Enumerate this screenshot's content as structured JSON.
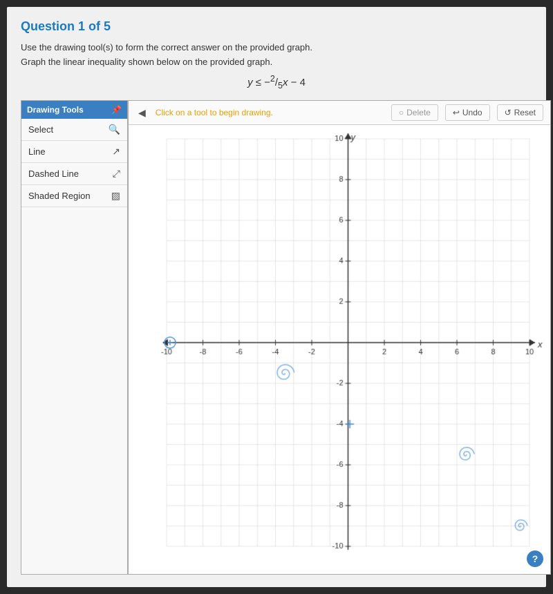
{
  "header": {
    "title": "Question 1 of 5"
  },
  "instructions": [
    "Use the drawing tool(s) to form the correct answer on the provided graph.",
    "Graph the linear inequality shown below on the provided graph."
  ],
  "equation": {
    "display": "y ≤ -²⁄₅x − 4"
  },
  "drawing_tools": {
    "header": "Drawing Tools",
    "tools": [
      {
        "name": "Select",
        "icon": "🔍"
      },
      {
        "name": "Line",
        "icon": "↗"
      },
      {
        "name": "Dashed Line",
        "icon": "↗"
      },
      {
        "name": "Shaded Region",
        "icon": "▨"
      }
    ]
  },
  "toolbar": {
    "collapse_label": "◀",
    "hint": "Click on a tool to begin drawing.",
    "delete_label": "Delete",
    "undo_label": "Undo",
    "reset_label": "Reset"
  },
  "graph": {
    "x_min": -10,
    "x_max": 10,
    "y_min": -10,
    "y_max": 10,
    "x_label": "x",
    "y_label": "y",
    "tick_interval": 2
  },
  "help": {
    "label": "?"
  }
}
